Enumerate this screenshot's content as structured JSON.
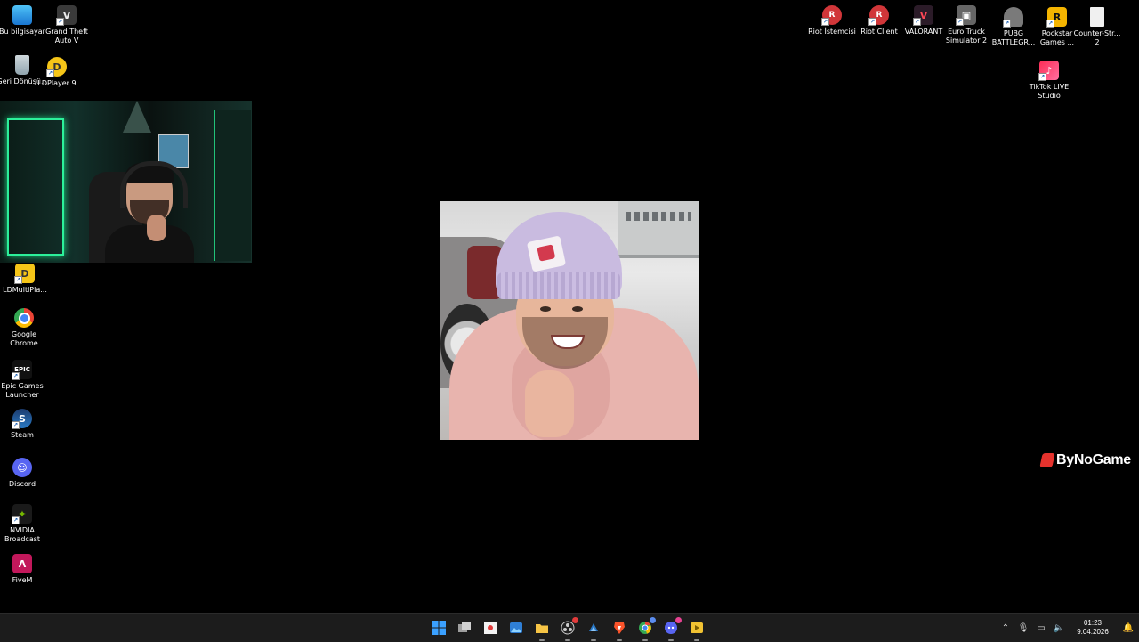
{
  "desktop_icons_left": [
    {
      "id": "this-pc",
      "label": "Bu bilgisayar",
      "color": "#2aa7e8"
    },
    {
      "id": "gta-v",
      "label": "Grand Theft Auto V",
      "color": "#444444"
    },
    {
      "id": "recycle-bin",
      "label": "Geri Dönüşü...",
      "color": "#9aa4ad"
    },
    {
      "id": "ldplayer",
      "label": "LDPlayer 9",
      "color": "#f5c518"
    },
    {
      "id": "ldmultiplayer",
      "label": "LDMultiPla...",
      "color": "#f5c518"
    },
    {
      "id": "chrome",
      "label": "Google Chrome",
      "color": "#34a853"
    },
    {
      "id": "epic",
      "label": "Epic Games Launcher",
      "color": "#222222"
    },
    {
      "id": "steam",
      "label": "Steam",
      "color": "#1b6ea8"
    },
    {
      "id": "discord",
      "label": "Discord",
      "color": "#5865f2"
    },
    {
      "id": "nvidia-broadcast",
      "label": "NVIDIA Broadcast",
      "color": "#1a1a1a"
    },
    {
      "id": "fivem",
      "label": "FiveM",
      "color": "#c2185b"
    }
  ],
  "desktop_icons_right": [
    {
      "id": "riot-istemcisi",
      "label": "Riot İstemcisi",
      "color": "#d13639"
    },
    {
      "id": "riot-client",
      "label": "Riot Client",
      "color": "#d13639"
    },
    {
      "id": "valorant",
      "label": "VALORANT",
      "color": "#2b1b28"
    },
    {
      "id": "euro-truck",
      "label": "Euro Truck Simulator 2",
      "color": "#666666"
    },
    {
      "id": "pubg",
      "label": "PUBG BATTLEGR...",
      "color": "#7a7a7a"
    },
    {
      "id": "rockstar",
      "label": "Rockstar Games ...",
      "color": "#f4b400"
    },
    {
      "id": "counter-strike",
      "label": "Counter-Str... 2",
      "color": "#f0f0f0"
    },
    {
      "id": "tiktok-live",
      "label": "TikTok LIVE Studio",
      "color": "#fe2c55"
    }
  ],
  "brand": {
    "text": "ByNoGame"
  },
  "taskbar": {
    "apps": [
      {
        "id": "start",
        "icon": "windows-icon",
        "color": "#3aa0ff"
      },
      {
        "id": "task-view",
        "icon": "task-view-icon",
        "color": "#bbbbbb"
      },
      {
        "id": "snipping",
        "icon": "snipping-tool-icon",
        "color": "#e0e0e0"
      },
      {
        "id": "photos",
        "icon": "photos-icon",
        "color": "#3aa0ff"
      },
      {
        "id": "explorer",
        "icon": "folder-icon",
        "color": "#f6c445"
      },
      {
        "id": "obs",
        "icon": "obs-icon",
        "color": "#d0d0d0"
      },
      {
        "id": "steam",
        "icon": "steam-icon",
        "color": "#2a79c7"
      },
      {
        "id": "brave",
        "icon": "brave-icon",
        "color": "#fb542b"
      },
      {
        "id": "chrome",
        "icon": "chrome-icon",
        "color": "#34a853"
      },
      {
        "id": "discord",
        "icon": "discord-icon",
        "color": "#5865f2"
      },
      {
        "id": "media",
        "icon": "media-player-icon",
        "color": "#f1c232"
      }
    ],
    "time": "01:23",
    "date": "9.04.2026"
  }
}
